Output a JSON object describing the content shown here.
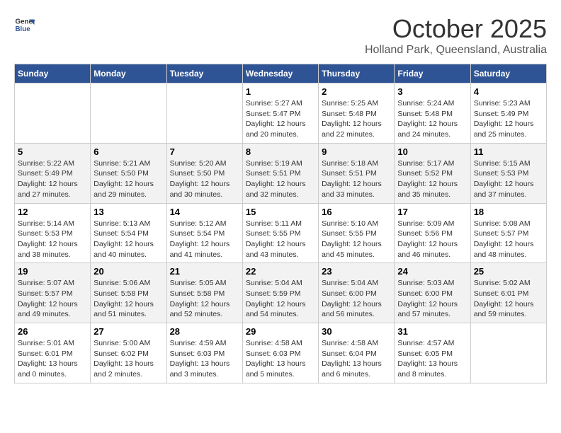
{
  "header": {
    "logo_line1": "General",
    "logo_line2": "Blue",
    "month": "October 2025",
    "location": "Holland Park, Queensland, Australia"
  },
  "weekdays": [
    "Sunday",
    "Monday",
    "Tuesday",
    "Wednesday",
    "Thursday",
    "Friday",
    "Saturday"
  ],
  "weeks": [
    {
      "days": [
        {
          "num": "",
          "info": ""
        },
        {
          "num": "",
          "info": ""
        },
        {
          "num": "",
          "info": ""
        },
        {
          "num": "1",
          "info": "Sunrise: 5:27 AM\nSunset: 5:47 PM\nDaylight: 12 hours\nand 20 minutes."
        },
        {
          "num": "2",
          "info": "Sunrise: 5:25 AM\nSunset: 5:48 PM\nDaylight: 12 hours\nand 22 minutes."
        },
        {
          "num": "3",
          "info": "Sunrise: 5:24 AM\nSunset: 5:48 PM\nDaylight: 12 hours\nand 24 minutes."
        },
        {
          "num": "4",
          "info": "Sunrise: 5:23 AM\nSunset: 5:49 PM\nDaylight: 12 hours\nand 25 minutes."
        }
      ]
    },
    {
      "days": [
        {
          "num": "5",
          "info": "Sunrise: 5:22 AM\nSunset: 5:49 PM\nDaylight: 12 hours\nand 27 minutes."
        },
        {
          "num": "6",
          "info": "Sunrise: 5:21 AM\nSunset: 5:50 PM\nDaylight: 12 hours\nand 29 minutes."
        },
        {
          "num": "7",
          "info": "Sunrise: 5:20 AM\nSunset: 5:50 PM\nDaylight: 12 hours\nand 30 minutes."
        },
        {
          "num": "8",
          "info": "Sunrise: 5:19 AM\nSunset: 5:51 PM\nDaylight: 12 hours\nand 32 minutes."
        },
        {
          "num": "9",
          "info": "Sunrise: 5:18 AM\nSunset: 5:51 PM\nDaylight: 12 hours\nand 33 minutes."
        },
        {
          "num": "10",
          "info": "Sunrise: 5:17 AM\nSunset: 5:52 PM\nDaylight: 12 hours\nand 35 minutes."
        },
        {
          "num": "11",
          "info": "Sunrise: 5:15 AM\nSunset: 5:53 PM\nDaylight: 12 hours\nand 37 minutes."
        }
      ]
    },
    {
      "days": [
        {
          "num": "12",
          "info": "Sunrise: 5:14 AM\nSunset: 5:53 PM\nDaylight: 12 hours\nand 38 minutes."
        },
        {
          "num": "13",
          "info": "Sunrise: 5:13 AM\nSunset: 5:54 PM\nDaylight: 12 hours\nand 40 minutes."
        },
        {
          "num": "14",
          "info": "Sunrise: 5:12 AM\nSunset: 5:54 PM\nDaylight: 12 hours\nand 41 minutes."
        },
        {
          "num": "15",
          "info": "Sunrise: 5:11 AM\nSunset: 5:55 PM\nDaylight: 12 hours\nand 43 minutes."
        },
        {
          "num": "16",
          "info": "Sunrise: 5:10 AM\nSunset: 5:55 PM\nDaylight: 12 hours\nand 45 minutes."
        },
        {
          "num": "17",
          "info": "Sunrise: 5:09 AM\nSunset: 5:56 PM\nDaylight: 12 hours\nand 46 minutes."
        },
        {
          "num": "18",
          "info": "Sunrise: 5:08 AM\nSunset: 5:57 PM\nDaylight: 12 hours\nand 48 minutes."
        }
      ]
    },
    {
      "days": [
        {
          "num": "19",
          "info": "Sunrise: 5:07 AM\nSunset: 5:57 PM\nDaylight: 12 hours\nand 49 minutes."
        },
        {
          "num": "20",
          "info": "Sunrise: 5:06 AM\nSunset: 5:58 PM\nDaylight: 12 hours\nand 51 minutes."
        },
        {
          "num": "21",
          "info": "Sunrise: 5:05 AM\nSunset: 5:58 PM\nDaylight: 12 hours\nand 52 minutes."
        },
        {
          "num": "22",
          "info": "Sunrise: 5:04 AM\nSunset: 5:59 PM\nDaylight: 12 hours\nand 54 minutes."
        },
        {
          "num": "23",
          "info": "Sunrise: 5:04 AM\nSunset: 6:00 PM\nDaylight: 12 hours\nand 56 minutes."
        },
        {
          "num": "24",
          "info": "Sunrise: 5:03 AM\nSunset: 6:00 PM\nDaylight: 12 hours\nand 57 minutes."
        },
        {
          "num": "25",
          "info": "Sunrise: 5:02 AM\nSunset: 6:01 PM\nDaylight: 12 hours\nand 59 minutes."
        }
      ]
    },
    {
      "days": [
        {
          "num": "26",
          "info": "Sunrise: 5:01 AM\nSunset: 6:01 PM\nDaylight: 13 hours\nand 0 minutes."
        },
        {
          "num": "27",
          "info": "Sunrise: 5:00 AM\nSunset: 6:02 PM\nDaylight: 13 hours\nand 2 minutes."
        },
        {
          "num": "28",
          "info": "Sunrise: 4:59 AM\nSunset: 6:03 PM\nDaylight: 13 hours\nand 3 minutes."
        },
        {
          "num": "29",
          "info": "Sunrise: 4:58 AM\nSunset: 6:03 PM\nDaylight: 13 hours\nand 5 minutes."
        },
        {
          "num": "30",
          "info": "Sunrise: 4:58 AM\nSunset: 6:04 PM\nDaylight: 13 hours\nand 6 minutes."
        },
        {
          "num": "31",
          "info": "Sunrise: 4:57 AM\nSunset: 6:05 PM\nDaylight: 13 hours\nand 8 minutes."
        },
        {
          "num": "",
          "info": ""
        }
      ]
    }
  ]
}
